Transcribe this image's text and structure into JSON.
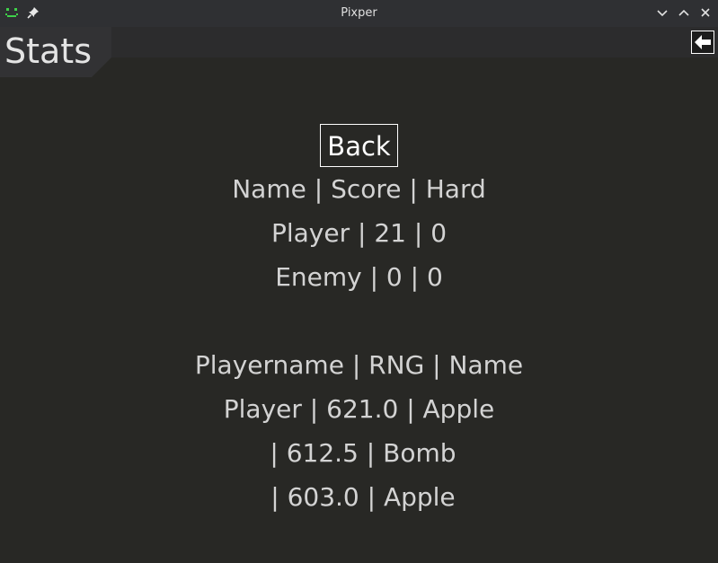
{
  "window": {
    "title": "Pixper"
  },
  "header": {
    "title": "Stats"
  },
  "buttons": {
    "back_label": "Back"
  },
  "score_table": {
    "header": "Name | Score | Hard",
    "rows": [
      "Player | 21 | 0",
      "Enemy | 0 | 0"
    ]
  },
  "rng_table": {
    "header": "Playername | RNG | Name",
    "rows": [
      "Player | 621.0 | Apple",
      " | 612.5 | Bomb",
      " | 603.0 | Apple"
    ]
  },
  "colors": {
    "background": "#282825",
    "titlebar": "#2f3033",
    "text": "#d3d3d3",
    "app_icon": "#3fd14a"
  },
  "icons": {
    "app": "pixel-face-icon",
    "pin": "pin-icon",
    "minimize": "chevron-down-icon",
    "maximize": "chevron-up-icon",
    "close": "close-icon",
    "nav_back": "arrow-left-icon"
  }
}
